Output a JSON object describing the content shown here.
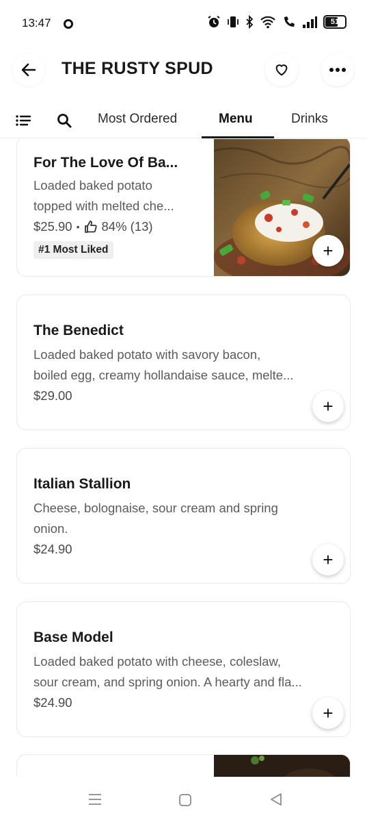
{
  "status_bar": {
    "time": "13:47",
    "battery": "51",
    "icons": [
      "alarm-icon",
      "vibrate-icon",
      "bluetooth-icon",
      "wifi-icon",
      "wifi-call-icon",
      "signal-icon",
      "battery-icon"
    ]
  },
  "header": {
    "title": "THE RUSTY SPUD",
    "back_icon": "back-arrow-icon",
    "favorite_icon": "heart-icon",
    "more_icon": "more-dots-icon"
  },
  "tabs": {
    "items": [
      {
        "label": "Most Ordered",
        "active": false
      },
      {
        "label": "Menu",
        "active": true
      },
      {
        "label": "Drinks",
        "active": false
      }
    ]
  },
  "menu_items": [
    {
      "name": "For The Love Of Ba...",
      "desc_line1": "Loaded baked potato",
      "desc_line2": "topped with melted che...",
      "price": "$25.90",
      "separator": "•",
      "rating": "84% (13)",
      "badge": "#1 Most Liked",
      "add": "+"
    },
    {
      "name": "The Benedict",
      "desc_line1": "Loaded baked potato with savory bacon,",
      "desc_line2": "boiled egg, creamy hollandaise sauce, melte...",
      "price": "$29.00",
      "add": "+"
    },
    {
      "name": "Italian Stallion",
      "desc_line1": "Cheese, bolognaise, sour cream and spring",
      "desc_line2": "onion.",
      "price": "$24.90",
      "add": "+"
    },
    {
      "name": "Base Model",
      "desc_line1": "Loaded baked potato with cheese, coleslaw,",
      "desc_line2": "sour cream, and spring onion. A hearty and fla...",
      "price": "$24.90",
      "add": "+"
    }
  ],
  "colors": {
    "text_primary": "#191919",
    "text_secondary": "#5b5b5b",
    "badge_bg": "#efefef"
  }
}
